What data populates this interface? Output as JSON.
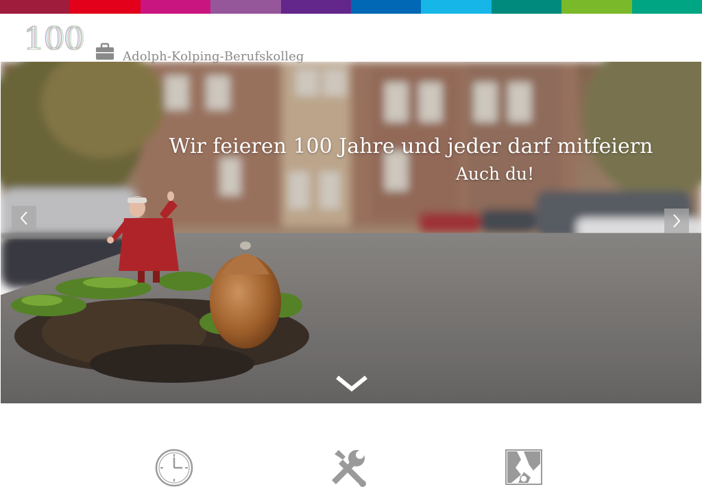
{
  "colors": {
    "stripe": [
      "#a01c3c",
      "#e2001a",
      "#c9157f",
      "#95569a",
      "#63268b",
      "#0068b4",
      "#17b6e8",
      "#008a7d",
      "#7ab929",
      "#00a583"
    ],
    "header_text": "#8a8a8a",
    "icon_gray": "#9a9a9a"
  },
  "header": {
    "logo_text": "100",
    "site_name": "Adolph-Kolping-Berufskolleg"
  },
  "hero": {
    "title": "Wir feieren 100 Jahre und jeder darf mitfeiern",
    "subtitle": "Auch du!",
    "prev_icon": "chevron-left-icon",
    "next_icon": "chevron-right-icon",
    "scroll_icon": "chevron-down-icon"
  },
  "features": [
    {
      "icon": "clock-icon"
    },
    {
      "icon": "tools-icon"
    },
    {
      "icon": "map-region-icon"
    }
  ]
}
